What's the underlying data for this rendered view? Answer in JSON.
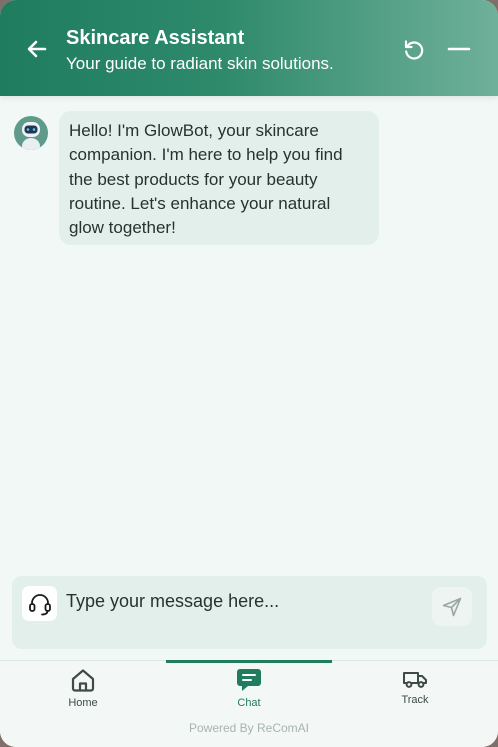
{
  "header": {
    "title": "Skincare Assistant",
    "subtitle": "Your guide to radiant skin solutions.",
    "back_icon": "arrow-left-icon",
    "refresh_icon": "refresh-icon",
    "minimize_icon": "minimize-icon"
  },
  "chat": {
    "bot_avatar_icon": "robot-icon",
    "messages": [
      {
        "sender": "bot",
        "text": "Hello! I'm GlowBot, your skincare companion. I'm here to help you find the best products for your beauty routine. Let's enhance your natural glow together!"
      }
    ]
  },
  "composer": {
    "placeholder": "Type your message here...",
    "support_icon": "headset-icon",
    "send_icon": "send-icon"
  },
  "nav": {
    "items": [
      {
        "label": "Home",
        "icon": "home-icon",
        "active": false
      },
      {
        "label": "Chat",
        "icon": "chat-icon",
        "active": true
      },
      {
        "label": "Track",
        "icon": "truck-icon",
        "active": false
      }
    ]
  },
  "footer": {
    "powered_by": "Powered By ReComAI"
  },
  "colors": {
    "brand": "#1f7c5f",
    "bubble": "#e2efea",
    "background": "#f1f8f5"
  }
}
